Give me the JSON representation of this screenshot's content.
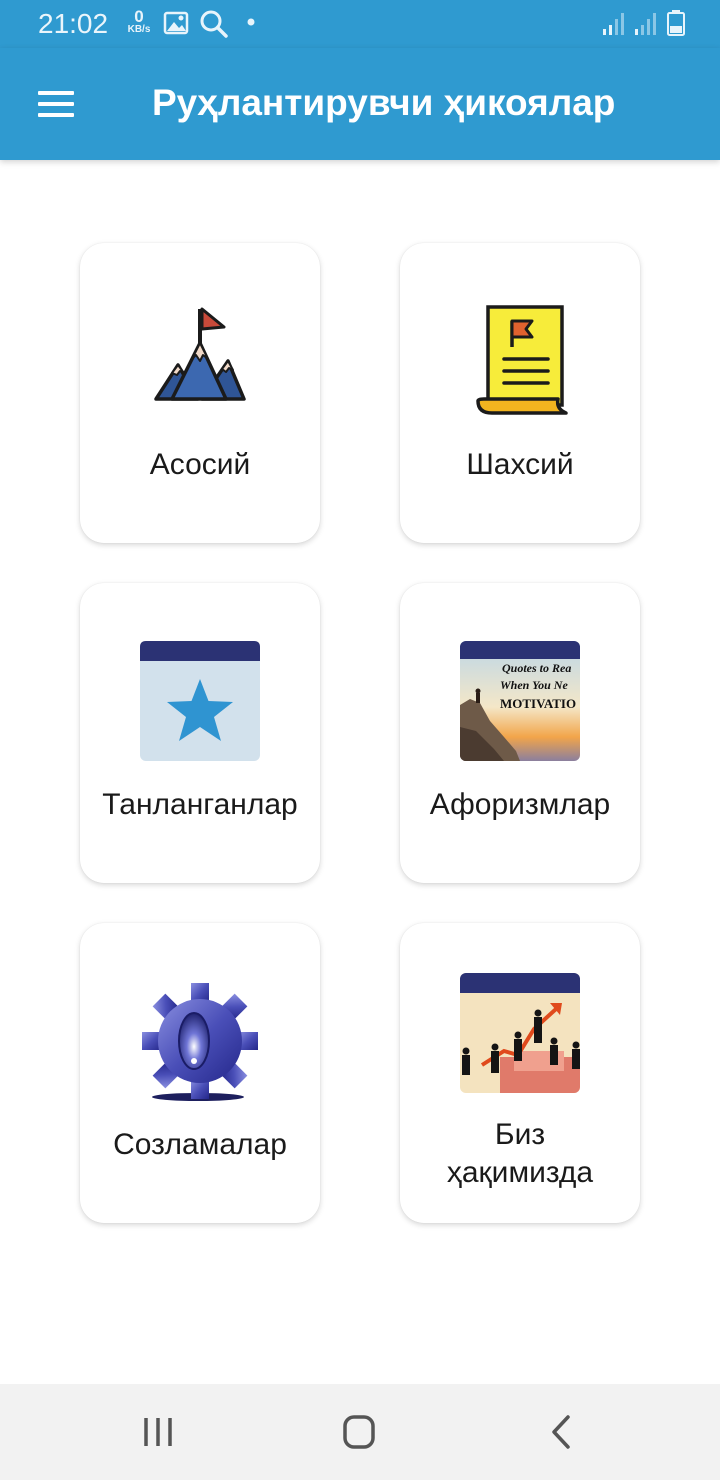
{
  "status_bar": {
    "time": "21:02",
    "net_speed_value": "0",
    "net_speed_unit": "KB/s",
    "icons": [
      "gallery-icon",
      "search-icon",
      "notification-dot-icon",
      "signal-icon",
      "signal-icon-2",
      "battery-icon"
    ]
  },
  "app_bar": {
    "title": "Руҳлантирувчи ҳикоялар",
    "menu_icon": "hamburger-menu-icon"
  },
  "tiles": [
    {
      "label": "Асосий",
      "icon": "mountain-flag-icon"
    },
    {
      "label": "Шахсий",
      "icon": "document-flag-icon"
    },
    {
      "label": "Танланганлар",
      "icon": "star-icon"
    },
    {
      "label": "Афоризмлар",
      "icon": "motivation-quotes-image",
      "image_text": [
        "Quotes to Rea",
        "When You Ne",
        "MOTIVATIO"
      ]
    },
    {
      "label": "Созламалар",
      "icon": "gear-icon"
    },
    {
      "label": "Биз ҳақимизда",
      "label_lines": [
        "Биз",
        "ҳақимизда"
      ],
      "icon": "business-growth-image"
    }
  ],
  "nav_bar": {
    "buttons": [
      "recent-apps-icon",
      "home-icon",
      "back-icon"
    ]
  },
  "colors": {
    "primary": "#2f9ad0",
    "card_bg": "#ffffff",
    "nav_bg": "#f2f2f2"
  }
}
